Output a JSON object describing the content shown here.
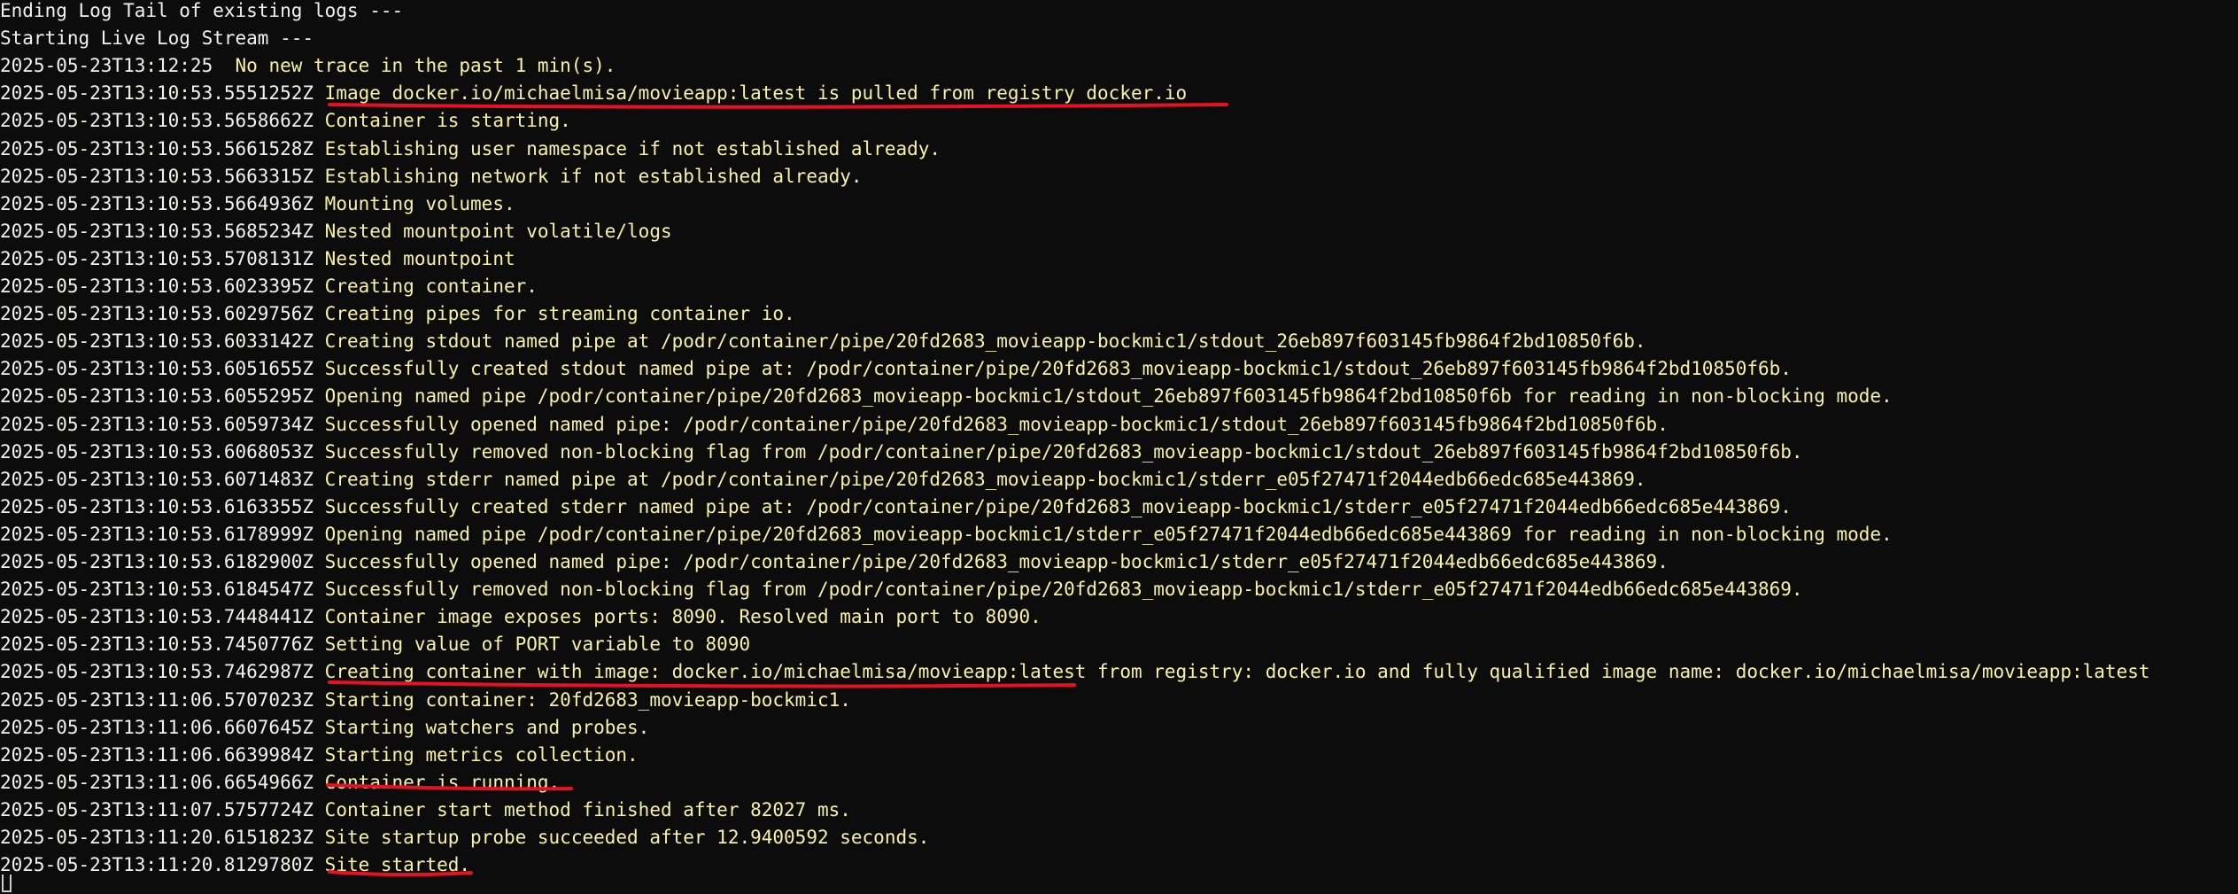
{
  "terminal": {
    "header_lines": [
      "Ending Log Tail of existing logs ---",
      "Starting Live Log Stream ---"
    ],
    "entries": [
      {
        "ts": "2025-05-23T13:12:25",
        "msg": "No new trace in the past 1 min(s)."
      },
      {
        "ts": "2025-05-23T13:10:53.5551252Z",
        "msg": "Image docker.io/michaelmisa/movieapp:latest is pulled from registry docker.io"
      },
      {
        "ts": "2025-05-23T13:10:53.5658662Z",
        "msg": "Container is starting."
      },
      {
        "ts": "2025-05-23T13:10:53.5661528Z",
        "msg": "Establishing user namespace if not established already."
      },
      {
        "ts": "2025-05-23T13:10:53.5663315Z",
        "msg": "Establishing network if not established already."
      },
      {
        "ts": "2025-05-23T13:10:53.5664936Z",
        "msg": "Mounting volumes."
      },
      {
        "ts": "2025-05-23T13:10:53.5685234Z",
        "msg": "Nested mountpoint volatile/logs"
      },
      {
        "ts": "2025-05-23T13:10:53.5708131Z",
        "msg": "Nested mountpoint"
      },
      {
        "ts": "2025-05-23T13:10:53.6023395Z",
        "msg": "Creating container."
      },
      {
        "ts": "2025-05-23T13:10:53.6029756Z",
        "msg": "Creating pipes for streaming container io."
      },
      {
        "ts": "2025-05-23T13:10:53.6033142Z",
        "msg": "Creating stdout named pipe at /podr/container/pipe/20fd2683_movieapp-bockmic1/stdout_26eb897f603145fb9864f2bd10850f6b."
      },
      {
        "ts": "2025-05-23T13:10:53.6051655Z",
        "msg": "Successfully created stdout named pipe at: /podr/container/pipe/20fd2683_movieapp-bockmic1/stdout_26eb897f603145fb9864f2bd10850f6b."
      },
      {
        "ts": "2025-05-23T13:10:53.6055295Z",
        "msg": "Opening named pipe /podr/container/pipe/20fd2683_movieapp-bockmic1/stdout_26eb897f603145fb9864f2bd10850f6b for reading in non-blocking mode."
      },
      {
        "ts": "2025-05-23T13:10:53.6059734Z",
        "msg": "Successfully opened named pipe: /podr/container/pipe/20fd2683_movieapp-bockmic1/stdout_26eb897f603145fb9864f2bd10850f6b."
      },
      {
        "ts": "2025-05-23T13:10:53.6068053Z",
        "msg": "Successfully removed non-blocking flag from /podr/container/pipe/20fd2683_movieapp-bockmic1/stdout_26eb897f603145fb9864f2bd10850f6b."
      },
      {
        "ts": "2025-05-23T13:10:53.6071483Z",
        "msg": "Creating stderr named pipe at /podr/container/pipe/20fd2683_movieapp-bockmic1/stderr_e05f27471f2044edb66edc685e443869."
      },
      {
        "ts": "2025-05-23T13:10:53.6163355Z",
        "msg": "Successfully created stderr named pipe at: /podr/container/pipe/20fd2683_movieapp-bockmic1/stderr_e05f27471f2044edb66edc685e443869."
      },
      {
        "ts": "2025-05-23T13:10:53.6178999Z",
        "msg": "Opening named pipe /podr/container/pipe/20fd2683_movieapp-bockmic1/stderr_e05f27471f2044edb66edc685e443869 for reading in non-blocking mode."
      },
      {
        "ts": "2025-05-23T13:10:53.6182900Z",
        "msg": "Successfully opened named pipe: /podr/container/pipe/20fd2683_movieapp-bockmic1/stderr_e05f27471f2044edb66edc685e443869."
      },
      {
        "ts": "2025-05-23T13:10:53.6184547Z",
        "msg": "Successfully removed non-blocking flag from /podr/container/pipe/20fd2683_movieapp-bockmic1/stderr_e05f27471f2044edb66edc685e443869."
      },
      {
        "ts": "2025-05-23T13:10:53.7448441Z",
        "msg": "Container image exposes ports: 8090. Resolved main port to 8090."
      },
      {
        "ts": "2025-05-23T13:10:53.7450776Z",
        "msg": "Setting value of PORT variable to 8090"
      },
      {
        "ts": "2025-05-23T13:10:53.7462987Z",
        "msg": "Creating container with image: docker.io/michaelmisa/movieapp:latest from registry: docker.io and fully qualified image name: docker.io/michaelmisa/movieapp:latest"
      },
      {
        "ts": "2025-05-23T13:11:06.5707023Z",
        "msg": "Starting container: 20fd2683_movieapp-bockmic1."
      },
      {
        "ts": "2025-05-23T13:11:06.6607645Z",
        "msg": "Starting watchers and probes."
      },
      {
        "ts": "2025-05-23T13:11:06.6639984Z",
        "msg": "Starting metrics collection."
      },
      {
        "ts": "2025-05-23T13:11:06.6654966Z",
        "msg": "Container is running."
      },
      {
        "ts": "2025-05-23T13:11:07.5757724Z",
        "msg": "Container start method finished after 82027 ms."
      },
      {
        "ts": "2025-05-23T13:11:20.6151823Z",
        "msg": "Site startup probe succeeded after 12.9400592 seconds."
      },
      {
        "ts": "2025-05-23T13:11:20.8129780Z",
        "msg": "Site started."
      }
    ],
    "colors": {
      "background": "#0c0c0c",
      "timestamp": "#f2f2f0",
      "message": "#f9f1a5",
      "annotation": "#e81123"
    }
  }
}
